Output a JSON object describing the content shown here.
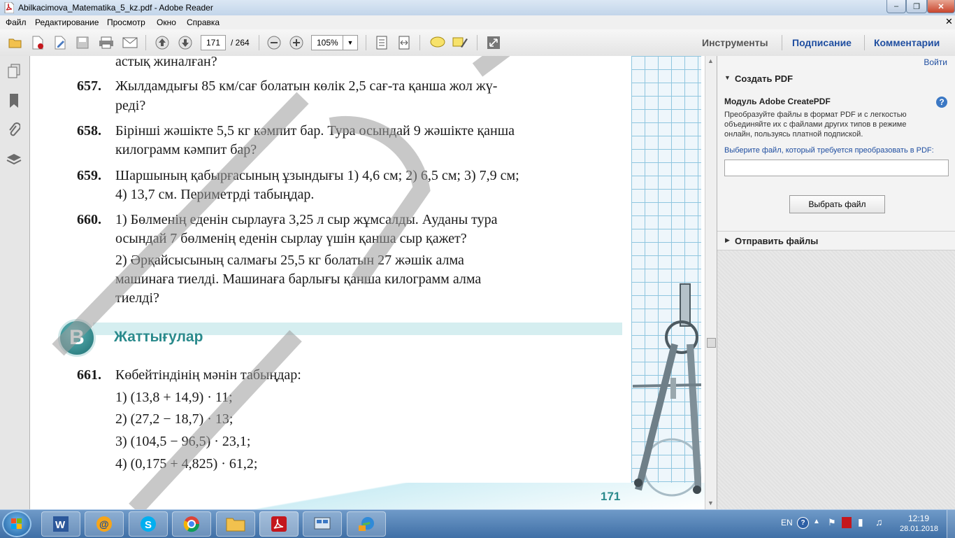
{
  "window": {
    "title": "Abilkacimova_Matematika_5_kz.pdf - Adobe Reader",
    "buttons": {
      "minimize": "‒",
      "restore": "❐",
      "close": "✕"
    }
  },
  "menu": [
    "Файл",
    "Редактирование",
    "Просмотр",
    "Окно",
    "Справка"
  ],
  "toolbar": {
    "page_current": "171",
    "page_total": "/ 264",
    "zoom": "105%",
    "links": {
      "tools": "Инструменты",
      "sign": "Подписание",
      "comments": "Комментарии"
    }
  },
  "document": {
    "lines": [
      {
        "indent": false,
        "num": "",
        "text": "астық жиналған?"
      },
      {
        "indent": false,
        "num": "657.",
        "text": "Жылдамдығы 85 км/сағ болатын көлік 2,5 сағ-та қанша жол жү-"
      },
      {
        "indent": true,
        "num": "",
        "text": "реді?"
      },
      {
        "indent": false,
        "num": "658.",
        "text": "Бірінші жәшікте 5,5 кг кәмпит бар. Тура осындай 9 жәшікте қанша"
      },
      {
        "indent": true,
        "num": "",
        "text": "килограмм кәмпит бар?"
      },
      {
        "indent": false,
        "num": "659.",
        "text": "Шаршының қабырғасының ұзындығы 1) 4,6 см; 2) 6,5 см; 3) 7,9 см;"
      },
      {
        "indent": true,
        "num": "",
        "text": "4) 13,7 см. Периметрді табыңдар."
      },
      {
        "indent": false,
        "num": "660.",
        "text": "1) Бөлменің еденін сырлауға 3,25 л сыр жұмсалды. Ауданы тура"
      },
      {
        "indent": true,
        "num": "",
        "text": "осындай 7 бөлменің еденін сырлау үшін қанша сыр қажет?"
      },
      {
        "indent": true,
        "num": "",
        "text": "2) Әрқайсысының салмағы 25,5 кг болатын 27 жәшік алма"
      },
      {
        "indent": true,
        "num": "",
        "text": "машинаға тиелді. Машинаға барлығы қанша килограмм алма"
      },
      {
        "indent": true,
        "num": "",
        "text": "тиелді?"
      }
    ],
    "section_letter": "B",
    "section_title": "Жаттығулар",
    "ex661": {
      "num": "661.",
      "text": "Көбейтіндінің мәнін табыңдар:",
      "items": [
        "1) (13,8 + 14,9) · 11;",
        "2) (27,2 − 18,7) · 13;",
        "3) (104,5 − 96,5) · 23,1;",
        "4) (0,175 + 4,825) · 61,2;"
      ]
    },
    "page_number": "171"
  },
  "right_panel": {
    "login": "Войти",
    "create_pdf": "Создать PDF",
    "module_title": "Модуль Adobe CreatePDF",
    "description": "Преобразуйте файлы в формат PDF и с легкостью объединяйте их с файлами других типов в режиме онлайн, пользуясь платной подпиской.",
    "select_label": "Выберите файл, который требуется преобразовать в PDF:",
    "choose_button": "Выбрать файл",
    "send_files": "Отправить файлы"
  },
  "taskbar": {
    "lang": "EN",
    "time": "12:19",
    "date": "28.01.2018"
  },
  "colors": {
    "accent_blue": "#1f4ea0",
    "section_teal": "#2a8a8c",
    "adobe_red": "#c4171d"
  }
}
